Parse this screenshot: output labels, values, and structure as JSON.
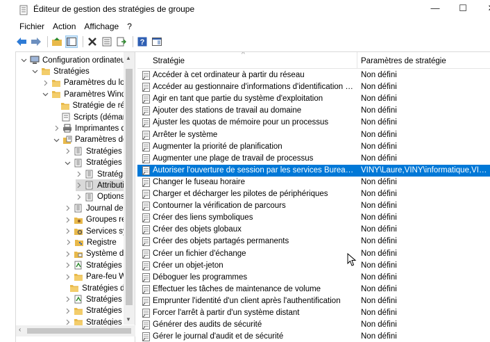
{
  "window": {
    "title": "Éditeur de gestion des stratégies de groupe",
    "minimize_glyph": "—",
    "maximize_glyph": "☐",
    "close_glyph": "✕"
  },
  "menu": [
    "Fichier",
    "Action",
    "Affichage",
    "?"
  ],
  "toolbar": {
    "icons": [
      "back-arrow-icon",
      "forward-arrow-icon",
      "up-folder-icon",
      "show-hide-tree-icon",
      "delete-icon",
      "properties-icon",
      "export-list-icon",
      "help-icon",
      "console-view-icon"
    ]
  },
  "tree": {
    "items": [
      {
        "label": "Configuration ordinateur",
        "level": 0,
        "chevron": "down",
        "icon": "computer-icon"
      },
      {
        "label": "Stratégies",
        "level": 1,
        "chevron": "down",
        "icon": "folder-icon"
      },
      {
        "label": "Paramètres du logiciel",
        "level": 2,
        "chevron": "right",
        "icon": "folder-icon"
      },
      {
        "label": "Paramètres Windows",
        "level": 2,
        "chevron": "down",
        "icon": "folder-icon"
      },
      {
        "label": "Stratégie de résolution de noms",
        "level": 3,
        "chevron": "",
        "icon": "folder-icon"
      },
      {
        "label": "Scripts (démarrage/arrêt)",
        "level": 3,
        "chevron": "",
        "icon": "script-icon"
      },
      {
        "label": "Imprimantes déployées",
        "level": 3,
        "chevron": "right",
        "icon": "printer-icon"
      },
      {
        "label": "Paramètres de sécurité",
        "level": 3,
        "chevron": "down",
        "icon": "security-settings-icon"
      },
      {
        "label": "Stratégies de comptes",
        "level": 4,
        "chevron": "right",
        "icon": "policy-folder-icon"
      },
      {
        "label": "Stratégies locales",
        "level": 4,
        "chevron": "down",
        "icon": "policy-folder-icon"
      },
      {
        "label": "Stratégie d'audit",
        "level": 5,
        "chevron": "right",
        "icon": "policy-folder-icon"
      },
      {
        "label": "Attribution des droits utilisateur",
        "level": 5,
        "chevron": "right",
        "icon": "policy-folder-icon",
        "selected": true
      },
      {
        "label": "Options de sécurité",
        "level": 5,
        "chevron": "right",
        "icon": "policy-folder-icon"
      },
      {
        "label": "Journal des événements",
        "level": 4,
        "chevron": "right",
        "icon": "policy-folder-icon"
      },
      {
        "label": "Groupes restreints",
        "level": 4,
        "chevron": "right",
        "icon": "group-folder-icon"
      },
      {
        "label": "Services système",
        "level": 4,
        "chevron": "right",
        "icon": "service-folder-icon"
      },
      {
        "label": "Registre",
        "level": 4,
        "chevron": "right",
        "icon": "registry-folder-icon"
      },
      {
        "label": "Système de fichiers",
        "level": 4,
        "chevron": "right",
        "icon": "filesystem-folder-icon"
      },
      {
        "label": "Stratégies de réseau filaire",
        "level": 4,
        "chevron": "right",
        "icon": "network-policy-icon"
      },
      {
        "label": "Pare-feu Windows",
        "level": 4,
        "chevron": "right",
        "icon": "folder-icon"
      },
      {
        "label": "Stratégies du gestionnaire de listes de réseaux",
        "level": 4,
        "chevron": "",
        "icon": "folder-icon"
      },
      {
        "label": "Stratégies de réseau sans fil",
        "level": 4,
        "chevron": "right",
        "icon": "network-policy-icon"
      },
      {
        "label": "Stratégies de clé publique",
        "level": 4,
        "chevron": "right",
        "icon": "folder-icon"
      },
      {
        "label": "Stratégies de restriction logicielle",
        "level": 4,
        "chevron": "right",
        "icon": "folder-icon"
      }
    ]
  },
  "list": {
    "columns": {
      "name": "Stratégie",
      "value": "Paramètres de stratégie"
    },
    "rows": [
      {
        "name": "Accéder à cet ordinateur à partir du réseau",
        "value": "Non défini"
      },
      {
        "name": "Accéder au gestionnaire d'informations d'identification en tant qu'appelant approuvé",
        "value": "Non défini"
      },
      {
        "name": "Agir en tant que partie du système d'exploitation",
        "value": "Non défini"
      },
      {
        "name": "Ajouter des stations de travail au domaine",
        "value": "Non défini"
      },
      {
        "name": "Ajuster les quotas de mémoire pour un processus",
        "value": "Non défini"
      },
      {
        "name": "Arrêter le système",
        "value": "Non défini"
      },
      {
        "name": "Augmenter la priorité de planification",
        "value": "Non défini"
      },
      {
        "name": "Augmenter une plage de travail de processus",
        "value": "Non défini"
      },
      {
        "name": "Autoriser l'ouverture de session par les services Bureau à distance",
        "value": "VINY\\Laure,VINY\\informatique,VINY\\Administrateurs",
        "selected": true
      },
      {
        "name": "Changer le fuseau horaire",
        "value": "Non défini"
      },
      {
        "name": "Charger et décharger les pilotes de périphériques",
        "value": "Non défini"
      },
      {
        "name": "Contourner la vérification de parcours",
        "value": "Non défini"
      },
      {
        "name": "Créer des liens symboliques",
        "value": "Non défini"
      },
      {
        "name": "Créer des objets globaux",
        "value": "Non défini"
      },
      {
        "name": "Créer des objets partagés permanents",
        "value": "Non défini"
      },
      {
        "name": "Créer un fichier d'échange",
        "value": "Non défini"
      },
      {
        "name": "Créer un objet-jeton",
        "value": "Non défini"
      },
      {
        "name": "Déboguer les programmes",
        "value": "Non défini"
      },
      {
        "name": "Effectuer les tâches de maintenance de volume",
        "value": "Non défini"
      },
      {
        "name": "Emprunter l'identité d'un client après l'authentification",
        "value": "Non défini"
      },
      {
        "name": "Forcer l'arrêt à partir d'un système distant",
        "value": "Non défini"
      },
      {
        "name": "Générer des audits de sécurité",
        "value": "Non défini"
      },
      {
        "name": "Gérer le journal d'audit et de sécurité",
        "value": "Non défini"
      }
    ]
  },
  "colors": {
    "selection": "#0078d7",
    "tree_selection": "#d9d9d9",
    "folder": "#e8b94a",
    "toolbar_arrow": "#2e7bd6"
  }
}
